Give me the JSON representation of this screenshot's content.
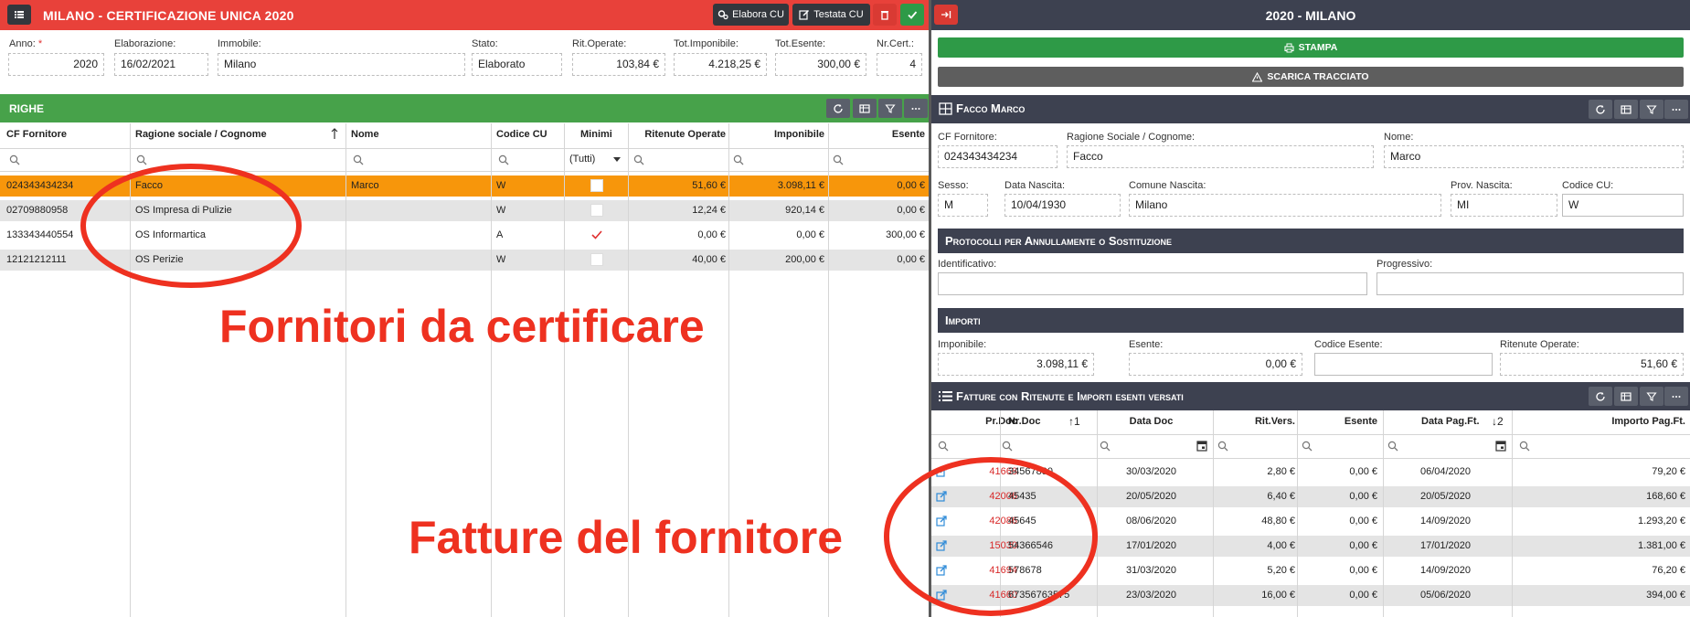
{
  "left": {
    "title": "MILANO - CERTIFICAZIONE UNICA 2020",
    "buttons": {
      "elabora": "Elabora CU",
      "testata": "Testata CU"
    },
    "fields": [
      {
        "label": "Anno:",
        "value": "2020",
        "required": "*"
      },
      {
        "label": "Elaborazione:",
        "value": "16/02/2021"
      },
      {
        "label": "Immobile:",
        "value": "Milano"
      },
      {
        "label": "Stato:",
        "value": "Elaborato"
      },
      {
        "label": "Rit.Operate:",
        "value": "103,84 €"
      },
      {
        "label": "Tot.Imponibile:",
        "value": "4.218,25 €"
      },
      {
        "label": "Tot.Esente:",
        "value": "300,00 €"
      },
      {
        "label": "Nr.Cert.:",
        "value": "4"
      }
    ],
    "section": "RIGHE",
    "grid": {
      "headers": [
        "CF Fornitore",
        "Ragione sociale / Cognome",
        "Nome",
        "Codice CU",
        "Minimi",
        "Ritenute Operate",
        "Imponibile",
        "Esente"
      ],
      "minimi_filter": "(Tutti)",
      "rows": [
        {
          "cf": "024343434234",
          "ragione": "Facco",
          "nome": "Marco",
          "codice": "W",
          "minimi": false,
          "ritenute": "51,60 €",
          "imponibile": "3.098,11 €",
          "esente": "0,00 €"
        },
        {
          "cf": "02709880958",
          "ragione": "OS Impresa di Pulizie",
          "nome": "",
          "codice": "W",
          "minimi": false,
          "ritenute": "12,24 €",
          "imponibile": "920,14 €",
          "esente": "0,00 €"
        },
        {
          "cf": "133343440554",
          "ragione": "OS Informartica",
          "nome": "",
          "codice": "A",
          "minimi": true,
          "ritenute": "0,00 €",
          "imponibile": "0,00 €",
          "esente": "300,00 €"
        },
        {
          "cf": "12121212111",
          "ragione": "OS Perizie",
          "nome": "",
          "codice": "W",
          "minimi": false,
          "ritenute": "40,00 €",
          "imponibile": "200,00 €",
          "esente": "0,00 €"
        }
      ]
    },
    "annotation": "Fornitori da certificare"
  },
  "right": {
    "title": "2020 - MILANO",
    "stampa": "STAMPA",
    "scarica": "SCARICA TRACCIATO",
    "detail_title": "Facco Marco",
    "fields": {
      "cf": {
        "label": "CF Fornitore:",
        "value": "024343434234"
      },
      "ragione": {
        "label": "Ragione Sociale / Cognome:",
        "value": "Facco"
      },
      "nome": {
        "label": "Nome:",
        "value": "Marco"
      },
      "sesso": {
        "label": "Sesso:",
        "value": "M"
      },
      "data_nascita": {
        "label": "Data Nascita:",
        "value": "10/04/1930"
      },
      "comune": {
        "label": "Comune Nascita:",
        "value": "Milano"
      },
      "prov": {
        "label": "Prov. Nascita:",
        "value": "MI"
      },
      "codice_cu": {
        "label": "Codice CU:",
        "value": "W"
      }
    },
    "protocolli": {
      "title": "Protocolli per Annullamente o Sostituzione",
      "identificativo": "Identificativo:",
      "progressivo": "Progressivo:"
    },
    "importi": {
      "title": "Importi",
      "imponibile": {
        "label": "Imponibile:",
        "value": "3.098,11 €"
      },
      "esente": {
        "label": "Esente:",
        "value": "0,00 €"
      },
      "codice_esente": {
        "label": "Codice Esente:",
        "value": ""
      },
      "ritenute": {
        "label": "Ritenute Operate:",
        "value": "51,60 €"
      }
    },
    "fatture": {
      "title": "Fatture con Ritenute e Importi esenti versati",
      "headers": [
        "Pr.Doc",
        "Nr.Doc",
        "Data Doc",
        "Rit.Vers.",
        "Esente",
        "Data Pag.Ft.",
        "Importo Pag.Ft."
      ],
      "sort1": "↑1",
      "sort2": "↓2",
      "rows": [
        {
          "pr": "41668",
          "nr": "34567890",
          "data": "30/03/2020",
          "rit": "2,80 €",
          "esente": "0,00 €",
          "pag": "06/04/2020",
          "importo": "79,20 €"
        },
        {
          "pr": "42006",
          "nr": "45435",
          "data": "20/05/2020",
          "rit": "6,40 €",
          "esente": "0,00 €",
          "pag": "20/05/2020",
          "importo": "168,60 €"
        },
        {
          "pr": "42086",
          "nr": "45645",
          "data": "08/06/2020",
          "rit": "48,80 €",
          "esente": "0,00 €",
          "pag": "14/09/2020",
          "importo": "1.293,20 €"
        },
        {
          "pr": "15030",
          "nr": "54366546",
          "data": "17/01/2020",
          "rit": "4,00 €",
          "esente": "0,00 €",
          "pag": "17/01/2020",
          "importo": "1.381,00 €"
        },
        {
          "pr": "41694",
          "nr": "578678",
          "data": "31/03/2020",
          "rit": "5,20 €",
          "esente": "0,00 €",
          "pag": "14/09/2020",
          "importo": "76,20 €"
        },
        {
          "pr": "41660",
          "nr": "67356763575",
          "data": "23/03/2020",
          "rit": "16,00 €",
          "esente": "0,00 €",
          "pag": "05/06/2020",
          "importo": "394,00 €"
        }
      ]
    },
    "annotation": "Fatture del fornitore"
  },
  "colors": {
    "title_red": "#e8413a",
    "green": "#47a24a",
    "dark": "#3d4150",
    "selected": "#f7960b",
    "annotation": "#ee3120"
  }
}
